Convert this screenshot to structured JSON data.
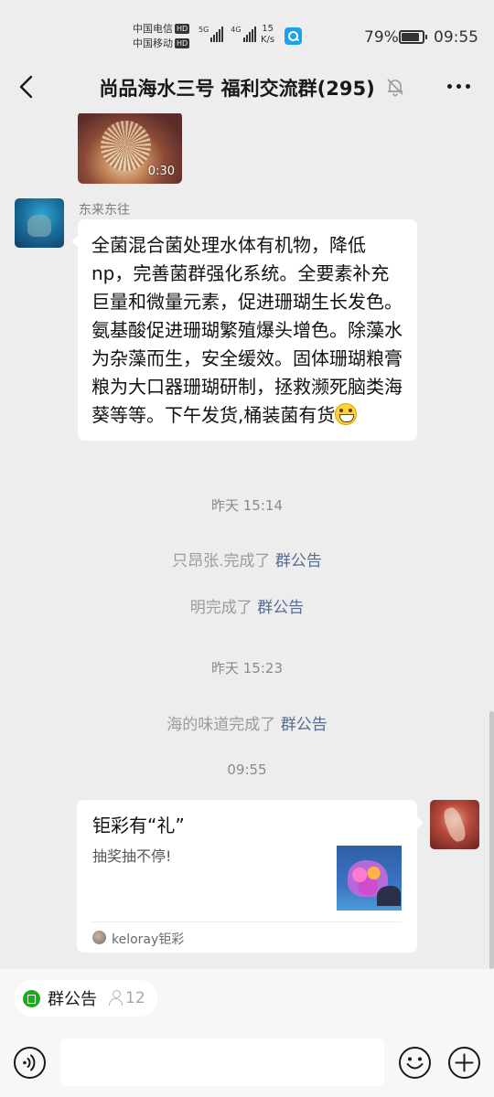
{
  "status_bar": {
    "carrier1": "中国电信",
    "carrier2": "中国移动",
    "hd_badge": "HD",
    "net1": "5G",
    "net2": "4G",
    "speed_value": "15",
    "speed_unit": "K/s",
    "battery_pct": "79%",
    "time": "09:55"
  },
  "nav": {
    "title": "尚品海水三号 福利交流群(295)"
  },
  "chat": {
    "video_duration": "0:30",
    "msg1": {
      "sender": "东来东往",
      "text": "全菌混合菌处理水体有机物，降低np，完善菌群强化系统。全要素补充巨量和微量元素，促进珊瑚生长发色。氨基酸促进珊瑚繁殖爆头增色。除藻水为杂藻而生，安全缓效。固体珊瑚粮膏粮为大口器珊瑚研制，拯救濒死脑类海葵等等。下午发货,桶装菌有货"
    },
    "ts1": "昨天 15:14",
    "sys1_text": "只昂张.完成了",
    "sys2_text": "明完成了",
    "ts2": "昨天 15:23",
    "sys3_text": "海的味道完成了",
    "notice_link": "群公告",
    "ts3": "09:55",
    "card": {
      "title": "钜彩有“礼”",
      "desc": "抽奖抽不停!",
      "source": "keloray钜彩"
    }
  },
  "bottom": {
    "notice_label": "群公告",
    "member_count": "12"
  }
}
